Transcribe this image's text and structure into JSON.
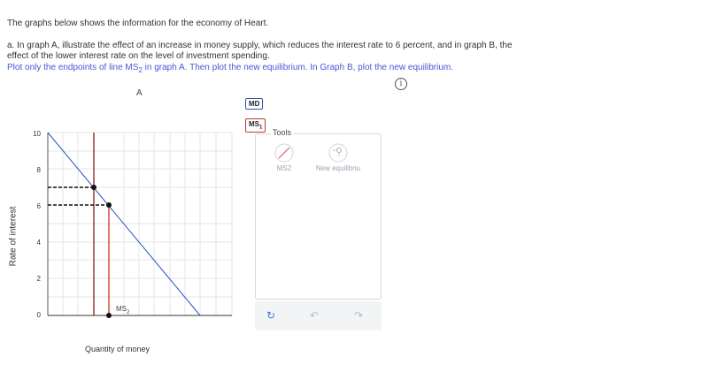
{
  "intro": "The graphs below shows the information for the economy of Heart.",
  "question_a_line1": "a. In graph A, illustrate the effect of an increase in money supply, which reduces the interest rate to 6 percent, and in graph B, the",
  "question_a_line2": "effect of the lower interest rate on the level of investment spending.",
  "instruction_pre": "Plot only the endpoints of line MS",
  "instruction_sub": "2",
  "instruction_post": " in graph A. Then plot the new equilibrium. In Graph B, plot the new equilibrium.",
  "graph": {
    "title": "A",
    "y_label": "Rate of interest",
    "x_label": "Quantity of money",
    "y_ticks": [
      "0",
      "2",
      "4",
      "6",
      "8",
      "10"
    ],
    "ms2_label": "MS",
    "ms2_sub": "2"
  },
  "legend": {
    "md": "MD",
    "ms1": "MS",
    "ms1_sub": "1"
  },
  "tools": {
    "label": "Tools",
    "items": [
      {
        "label": "MS2",
        "icon": "line-tool-icon"
      },
      {
        "label": "New equilibriu",
        "icon": "point-tool-icon"
      }
    ]
  },
  "bottom_icons": [
    "reset-icon",
    "undo-icon",
    "redo-icon"
  ],
  "colors": {
    "md": "#2a55c8",
    "ms1": "#8b1a1a",
    "ms2": "#d0321e",
    "instruction": "#4a56d6"
  }
}
